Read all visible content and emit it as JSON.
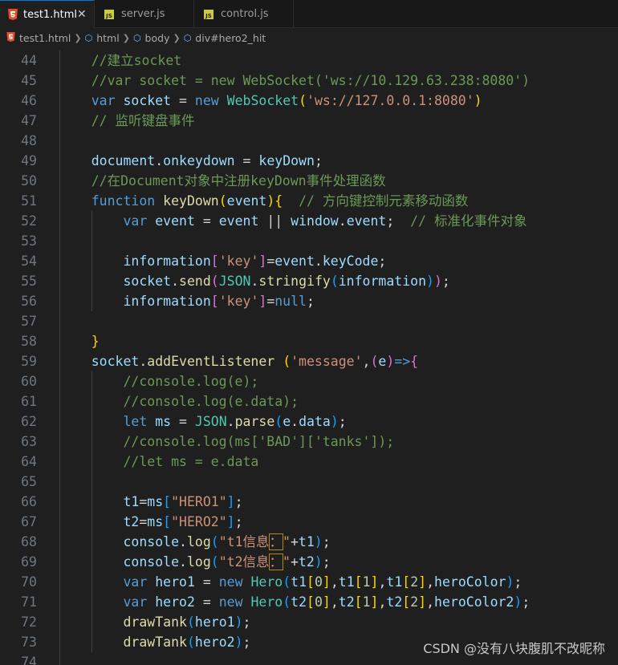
{
  "tabs": [
    {
      "label": "test1.html",
      "icon": "html5-icon",
      "active": true
    },
    {
      "label": "server.js",
      "icon": "js-icon",
      "active": false
    },
    {
      "label": "control.js",
      "icon": "js-icon",
      "active": false
    }
  ],
  "breadcrumb": [
    "test1.html",
    "html",
    "body",
    "div#hero2_hit"
  ],
  "watermark": "CSDN @没有八块腹肌不改昵称",
  "lines": [
    {
      "n": "44",
      "t": [
        [
          "c-com",
          "    //建立socket"
        ]
      ]
    },
    {
      "n": "45",
      "t": [
        [
          "c-com",
          "    //var socket = new WebSocket('ws://10.129.63.238:8080')"
        ]
      ]
    },
    {
      "n": "46",
      "t": [
        [
          "c-op",
          "    "
        ],
        [
          "c-kw",
          "var"
        ],
        [
          "c-op",
          " "
        ],
        [
          "c-var",
          "socket"
        ],
        [
          "c-op",
          " = "
        ],
        [
          "c-kw",
          "new"
        ],
        [
          "c-op",
          " "
        ],
        [
          "c-cls",
          "WebSocket"
        ],
        [
          "c-p1",
          "("
        ],
        [
          "c-str",
          "'ws://127.0.0.1:8080'"
        ],
        [
          "c-p1",
          ")"
        ]
      ]
    },
    {
      "n": "47",
      "t": [
        [
          "c-com",
          "    // 监听键盘事件"
        ]
      ]
    },
    {
      "n": "48",
      "t": []
    },
    {
      "n": "49",
      "t": [
        [
          "c-op",
          "    "
        ],
        [
          "c-var",
          "document"
        ],
        [
          "c-op",
          "."
        ],
        [
          "c-var",
          "onkeydown"
        ],
        [
          "c-op",
          " = "
        ],
        [
          "c-var",
          "keyDown"
        ],
        [
          "c-op",
          ";"
        ]
      ]
    },
    {
      "n": "50",
      "t": [
        [
          "c-com",
          "    //在Document对象中注册keyDown事件处理函数"
        ]
      ]
    },
    {
      "n": "51",
      "t": [
        [
          "c-op",
          "    "
        ],
        [
          "c-kw",
          "function"
        ],
        [
          "c-op",
          " "
        ],
        [
          "c-fn",
          "keyDown"
        ],
        [
          "c-p1",
          "("
        ],
        [
          "c-var",
          "event"
        ],
        [
          "c-p1",
          ")"
        ],
        [
          "c-p1",
          "{"
        ],
        [
          "c-op",
          "  "
        ],
        [
          "c-com",
          "// 方向键控制元素移动函数"
        ]
      ]
    },
    {
      "n": "52",
      "t": [
        [
          "c-op",
          "        "
        ],
        [
          "c-kw",
          "var"
        ],
        [
          "c-op",
          " "
        ],
        [
          "c-var",
          "event"
        ],
        [
          "c-op",
          " = "
        ],
        [
          "c-var",
          "event"
        ],
        [
          "c-op",
          " || "
        ],
        [
          "c-var",
          "window"
        ],
        [
          "c-op",
          "."
        ],
        [
          "c-var",
          "event"
        ],
        [
          "c-op",
          ";  "
        ],
        [
          "c-com",
          "// 标准化事件对象"
        ]
      ]
    },
    {
      "n": "53",
      "t": []
    },
    {
      "n": "54",
      "t": [
        [
          "c-op",
          "        "
        ],
        [
          "c-var",
          "information"
        ],
        [
          "c-p2",
          "["
        ],
        [
          "c-str",
          "'key'"
        ],
        [
          "c-p2",
          "]"
        ],
        [
          "c-op",
          "="
        ],
        [
          "c-var",
          "event"
        ],
        [
          "c-op",
          "."
        ],
        [
          "c-var",
          "keyCode"
        ],
        [
          "c-op",
          ";"
        ]
      ]
    },
    {
      "n": "55",
      "t": [
        [
          "c-op",
          "        "
        ],
        [
          "c-var",
          "socket"
        ],
        [
          "c-op",
          "."
        ],
        [
          "c-fn",
          "send"
        ],
        [
          "c-p2",
          "("
        ],
        [
          "c-cls",
          "JSON"
        ],
        [
          "c-op",
          "."
        ],
        [
          "c-fn",
          "stringify"
        ],
        [
          "c-p3",
          "("
        ],
        [
          "c-var",
          "information"
        ],
        [
          "c-p3",
          ")"
        ],
        [
          "c-p2",
          ")"
        ],
        [
          "c-op",
          ";"
        ]
      ]
    },
    {
      "n": "56",
      "t": [
        [
          "c-op",
          "        "
        ],
        [
          "c-var",
          "information"
        ],
        [
          "c-p2",
          "["
        ],
        [
          "c-str",
          "'key'"
        ],
        [
          "c-p2",
          "]"
        ],
        [
          "c-op",
          "="
        ],
        [
          "c-kw",
          "null"
        ],
        [
          "c-op",
          ";"
        ]
      ]
    },
    {
      "n": "57",
      "t": []
    },
    {
      "n": "58",
      "t": [
        [
          "c-op",
          "    "
        ],
        [
          "c-p1",
          "}"
        ]
      ]
    },
    {
      "n": "59",
      "t": [
        [
          "c-op",
          "    "
        ],
        [
          "c-var",
          "socket"
        ],
        [
          "c-op",
          "."
        ],
        [
          "c-fn",
          "addEventListener"
        ],
        [
          "c-op",
          " "
        ],
        [
          "c-p1",
          "("
        ],
        [
          "c-str",
          "'message'"
        ],
        [
          "c-op",
          ","
        ],
        [
          "c-p2",
          "("
        ],
        [
          "c-var",
          "e"
        ],
        [
          "c-p2",
          ")"
        ],
        [
          "c-kw",
          "=>"
        ],
        [
          "c-p2",
          "{"
        ]
      ]
    },
    {
      "n": "60",
      "t": [
        [
          "c-com",
          "        //console.log(e);"
        ]
      ]
    },
    {
      "n": "61",
      "t": [
        [
          "c-com",
          "        //console.log(e.data);"
        ]
      ]
    },
    {
      "n": "62",
      "t": [
        [
          "c-op",
          "        "
        ],
        [
          "c-kw",
          "let"
        ],
        [
          "c-op",
          " "
        ],
        [
          "c-var",
          "ms"
        ],
        [
          "c-op",
          " = "
        ],
        [
          "c-cls",
          "JSON"
        ],
        [
          "c-op",
          "."
        ],
        [
          "c-fn",
          "parse"
        ],
        [
          "c-p3",
          "("
        ],
        [
          "c-var",
          "e"
        ],
        [
          "c-op",
          "."
        ],
        [
          "c-var",
          "data"
        ],
        [
          "c-p3",
          ")"
        ],
        [
          "c-op",
          ";"
        ]
      ]
    },
    {
      "n": "63",
      "t": [
        [
          "c-com",
          "        //console.log(ms['BAD']['tanks']);"
        ]
      ]
    },
    {
      "n": "64",
      "t": [
        [
          "c-com",
          "        //let ms = e.data"
        ]
      ]
    },
    {
      "n": "65",
      "t": []
    },
    {
      "n": "66",
      "t": [
        [
          "c-op",
          "        "
        ],
        [
          "c-var",
          "t1"
        ],
        [
          "c-op",
          "="
        ],
        [
          "c-var",
          "ms"
        ],
        [
          "c-p3",
          "["
        ],
        [
          "c-str",
          "\"HERO1\""
        ],
        [
          "c-p3",
          "]"
        ],
        [
          "c-op",
          ";"
        ]
      ]
    },
    {
      "n": "67",
      "t": [
        [
          "c-op",
          "        "
        ],
        [
          "c-var",
          "t2"
        ],
        [
          "c-op",
          "="
        ],
        [
          "c-var",
          "ms"
        ],
        [
          "c-p3",
          "["
        ],
        [
          "c-str",
          "\"HERO2\""
        ],
        [
          "c-p3",
          "]"
        ],
        [
          "c-op",
          ";"
        ]
      ]
    },
    {
      "n": "68",
      "t": [
        [
          "c-op",
          "        "
        ],
        [
          "c-var",
          "console"
        ],
        [
          "c-op",
          "."
        ],
        [
          "c-fn",
          "log"
        ],
        [
          "c-p3",
          "("
        ],
        [
          "c-str",
          "\"t1信息"
        ],
        [
          "c-str hl",
          "："
        ],
        [
          "c-str",
          "\""
        ],
        [
          "c-op",
          "+"
        ],
        [
          "c-var",
          "t1"
        ],
        [
          "c-p3",
          ")"
        ],
        [
          "c-op",
          ";"
        ]
      ]
    },
    {
      "n": "69",
      "t": [
        [
          "c-op",
          "        "
        ],
        [
          "c-var",
          "console"
        ],
        [
          "c-op",
          "."
        ],
        [
          "c-fn",
          "log"
        ],
        [
          "c-p3",
          "("
        ],
        [
          "c-str",
          "\"t2信息"
        ],
        [
          "c-str hl",
          "："
        ],
        [
          "c-str",
          "\""
        ],
        [
          "c-op",
          "+"
        ],
        [
          "c-var",
          "t2"
        ],
        [
          "c-p3",
          ")"
        ],
        [
          "c-op",
          ";"
        ]
      ]
    },
    {
      "n": "70",
      "t": [
        [
          "c-op",
          "        "
        ],
        [
          "c-kw",
          "var"
        ],
        [
          "c-op",
          " "
        ],
        [
          "c-var",
          "hero1"
        ],
        [
          "c-op",
          " = "
        ],
        [
          "c-kw",
          "new"
        ],
        [
          "c-op",
          " "
        ],
        [
          "c-cls",
          "Hero"
        ],
        [
          "c-p3",
          "("
        ],
        [
          "c-var",
          "t1"
        ],
        [
          "c-p1",
          "["
        ],
        [
          "c-num",
          "0"
        ],
        [
          "c-p1",
          "]"
        ],
        [
          "c-op",
          ","
        ],
        [
          "c-var",
          "t1"
        ],
        [
          "c-p1",
          "["
        ],
        [
          "c-num",
          "1"
        ],
        [
          "c-p1",
          "]"
        ],
        [
          "c-op",
          ","
        ],
        [
          "c-var",
          "t1"
        ],
        [
          "c-p1",
          "["
        ],
        [
          "c-num",
          "2"
        ],
        [
          "c-p1",
          "]"
        ],
        [
          "c-op",
          ","
        ],
        [
          "c-var",
          "heroColor"
        ],
        [
          "c-p3",
          ")"
        ],
        [
          "c-op",
          ";"
        ]
      ]
    },
    {
      "n": "71",
      "t": [
        [
          "c-op",
          "        "
        ],
        [
          "c-kw",
          "var"
        ],
        [
          "c-op",
          " "
        ],
        [
          "c-var",
          "hero2"
        ],
        [
          "c-op",
          " = "
        ],
        [
          "c-kw",
          "new"
        ],
        [
          "c-op",
          " "
        ],
        [
          "c-cls",
          "Hero"
        ],
        [
          "c-p3",
          "("
        ],
        [
          "c-var",
          "t2"
        ],
        [
          "c-p1",
          "["
        ],
        [
          "c-num",
          "0"
        ],
        [
          "c-p1",
          "]"
        ],
        [
          "c-op",
          ","
        ],
        [
          "c-var",
          "t2"
        ],
        [
          "c-p1",
          "["
        ],
        [
          "c-num",
          "1"
        ],
        [
          "c-p1",
          "]"
        ],
        [
          "c-op",
          ","
        ],
        [
          "c-var",
          "t2"
        ],
        [
          "c-p1",
          "["
        ],
        [
          "c-num",
          "2"
        ],
        [
          "c-p1",
          "]"
        ],
        [
          "c-op",
          ","
        ],
        [
          "c-var",
          "heroColor2"
        ],
        [
          "c-p3",
          ")"
        ],
        [
          "c-op",
          ";"
        ]
      ]
    },
    {
      "n": "72",
      "t": [
        [
          "c-op",
          "        "
        ],
        [
          "c-fn",
          "drawTank"
        ],
        [
          "c-p3",
          "("
        ],
        [
          "c-var",
          "hero1"
        ],
        [
          "c-p3",
          ")"
        ],
        [
          "c-op",
          ";"
        ]
      ]
    },
    {
      "n": "73",
      "t": [
        [
          "c-op",
          "        "
        ],
        [
          "c-fn",
          "drawTank"
        ],
        [
          "c-p3",
          "("
        ],
        [
          "c-var",
          "hero2"
        ],
        [
          "c-p3",
          ")"
        ],
        [
          "c-op",
          ";"
        ]
      ]
    },
    {
      "n": "74",
      "t": []
    }
  ]
}
